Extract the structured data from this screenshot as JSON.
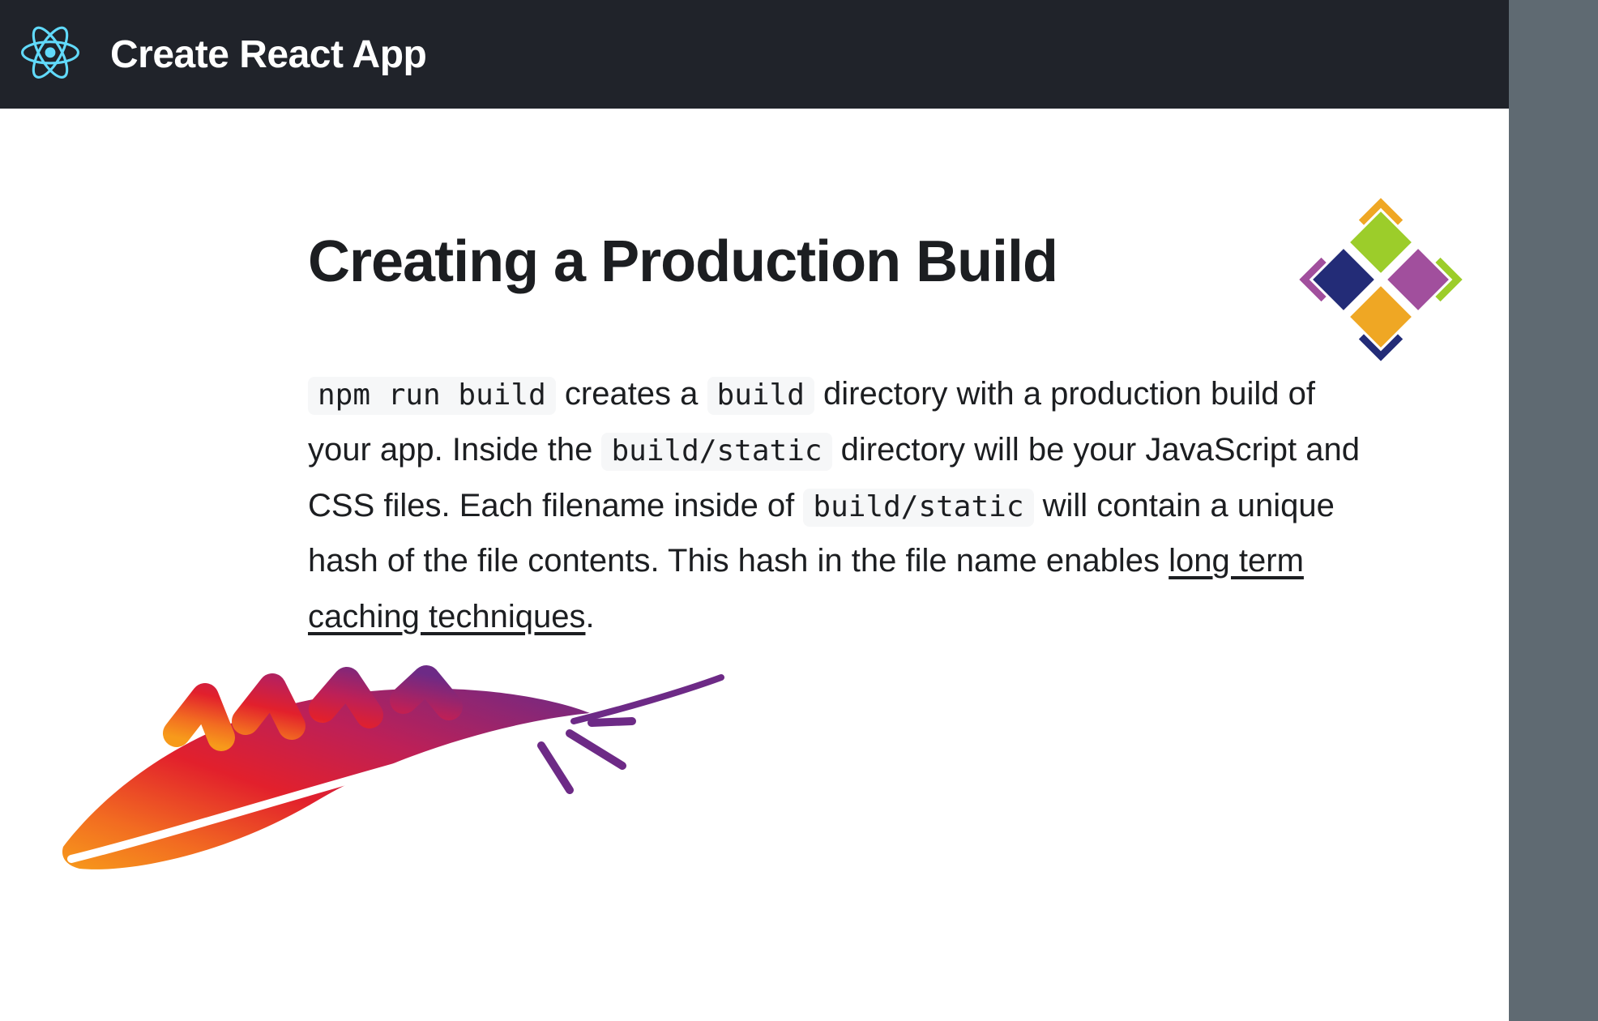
{
  "navbar": {
    "title": "Create React App"
  },
  "page": {
    "heading": "Creating a Production Build",
    "paragraph": {
      "code1": "npm run build",
      "text1": " creates a ",
      "code2": "build",
      "text2": " directory with a production build of your app. Inside the ",
      "code3": "build/static",
      "text3": " directory will be your JavaScript and CSS files. Each filename inside of ",
      "code4": "build/static",
      "text4": " will contain a unique hash of the file contents. This hash in the file name enables ",
      "link": "long term caching techniques",
      "text5": "."
    }
  },
  "icons": {
    "react": "react-logo",
    "centos": "centos-logo",
    "apache": "apache-feather"
  }
}
